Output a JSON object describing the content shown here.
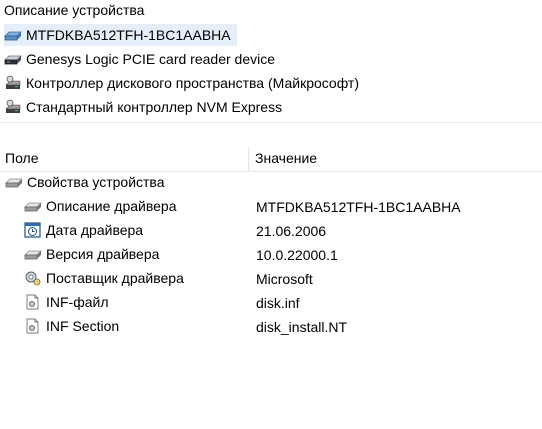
{
  "header": {
    "title": "Описание устройства"
  },
  "devices": [
    {
      "label": "MTFDKBA512TFH-1BC1AABHA",
      "icon": "disk-drive-icon",
      "selected": true
    },
    {
      "label": "Genesys Logic PCIE card reader device",
      "icon": "disk-drive-icon"
    },
    {
      "label": "Контроллер дискового пространства (Майкрософт)",
      "icon": "storage-controller-icon"
    },
    {
      "label": "Стандартный контроллер NVM Express",
      "icon": "storage-controller-icon"
    }
  ],
  "table": {
    "col_field": "Поле",
    "col_value": "Значение",
    "group": "Свойства устройства",
    "rows": [
      {
        "name": "Описание драйвера",
        "value": "MTFDKBA512TFH-1BC1AABHA",
        "icon": "disk-drive-icon"
      },
      {
        "name": "Дата драйвера",
        "value": "21.06.2006",
        "icon": "calendar-icon"
      },
      {
        "name": "Версия драйвера",
        "value": "10.0.22000.1",
        "icon": "disk-drive-icon"
      },
      {
        "name": "Поставщик драйвера",
        "value": "Microsoft",
        "icon": "gear-provider-icon"
      },
      {
        "name": "INF-файл",
        "value": "disk.inf",
        "icon": "inf-file-icon"
      },
      {
        "name": "INF Section",
        "value": "disk_install.NT",
        "icon": "inf-file-icon"
      }
    ]
  }
}
